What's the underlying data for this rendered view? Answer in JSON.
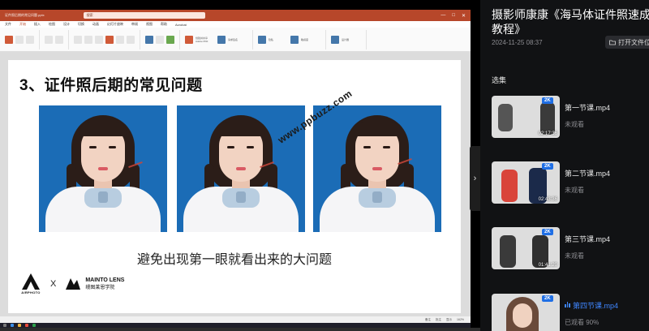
{
  "ppt": {
    "window_title": "证件照后期的常见问题.pptx",
    "search_placeholder": "搜索",
    "window_controls": [
      "—",
      "□",
      "✕"
    ],
    "menu_items": [
      "文件",
      "开始",
      "插入",
      "绘图",
      "设计",
      "切换",
      "动画",
      "幻灯片放映",
      "审阅",
      "视图",
      "帮助",
      "Acrobat"
    ],
    "active_menu": "开始",
    "ribbon_labels": [
      "创建并共享 Adobe PDF",
      "请求签名",
      "隐私",
      "敏感度",
      "设计器"
    ],
    "status_items": [
      "备注",
      "批注",
      "显示",
      "",
      "",
      "",
      "",
      "162%"
    ]
  },
  "slide": {
    "title": "3、证件照后期的常见问题",
    "watermark": "www.ppbuzz.com",
    "subtitle": "避免出现第一眼就看出来的大问题",
    "logo_left": "AIRPHOTO",
    "logo_x": "X",
    "logo_right_line1": "MAINTO LENS",
    "logo_right_line2": "缦图莱恩学院",
    "photos": [
      "photo-1",
      "photo-2",
      "photo-3"
    ],
    "photo_bg": "#1b6cb6"
  },
  "panel": {
    "title": "摄影师康康《海马体证件照速成教程》",
    "date": "2024-11-25 08:37",
    "open_file_label": "打开文件位置",
    "section_label": "选集",
    "episodes": [
      {
        "name": "第一节课.mp4",
        "status": "未观看",
        "badge": "2K",
        "duration": "02:17:36",
        "active": false
      },
      {
        "name": "第二节课.mp4",
        "status": "未观看",
        "badge": "2K",
        "duration": "02:43:36",
        "active": false
      },
      {
        "name": "第三节课.mp4",
        "status": "未观看",
        "badge": "2K",
        "duration": "01:41:20",
        "active": false
      },
      {
        "name": "第四节课.mp4",
        "status": "已观看 90%",
        "badge": "2K",
        "duration": "",
        "active": true
      }
    ],
    "accent_color": "#3f86ff"
  },
  "player": {
    "collapse_icon": "›"
  }
}
